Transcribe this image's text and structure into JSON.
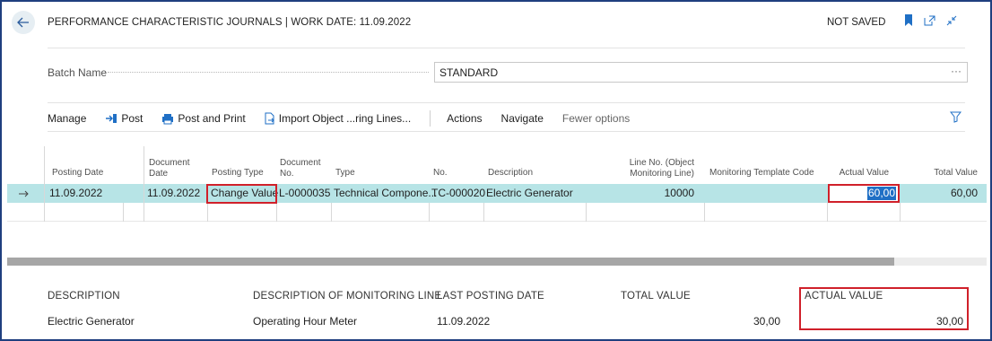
{
  "header": {
    "title": "PERFORMANCE CHARACTERISTIC JOURNALS | WORK DATE: 11.09.2022",
    "status": "NOT SAVED"
  },
  "batch": {
    "label": "Batch Name",
    "value": "STANDARD",
    "more": "···"
  },
  "actions": {
    "manage": "Manage",
    "post": "Post",
    "post_and_print": "Post and Print",
    "import": "Import Object ...ring Lines...",
    "actions": "Actions",
    "navigate": "Navigate",
    "fewer_options": "Fewer options"
  },
  "columns": {
    "posting_date": "Posting Date",
    "document_date": [
      "Document",
      "Date"
    ],
    "posting_type": "Posting Type",
    "document_no": [
      "Document",
      "No."
    ],
    "type": "Type",
    "no": "No.",
    "description": "Description",
    "line_no": [
      "Line No. (Object",
      "Monitoring Line)"
    ],
    "monitoring_template_code": "Monitoring Template Code",
    "actual_value": "Actual Value",
    "total_value": "Total Value"
  },
  "rows": [
    {
      "posting_date": "11.09.2022",
      "document_date": "11.09.2022",
      "posting_type": "Change Value",
      "document_no": "L-0000035",
      "type": "Technical Compone...",
      "no": "TC-000020",
      "description": "Electric Generator",
      "line_no": "10000",
      "monitoring_template_code": "",
      "actual_value": "60,00",
      "total_value": "60,00"
    }
  ],
  "factbox": {
    "description_label": "DESCRIPTION",
    "description_value": "Electric Generator",
    "monitoring_line_label": "DESCRIPTION OF MONITORING LINE",
    "monitoring_line_value": "Operating Hour Meter",
    "last_posting_label": "LAST POSTING DATE",
    "last_posting_value": "11.09.2022",
    "total_value_label": "TOTAL VALUE",
    "total_value_value": "30,00",
    "actual_value_label": "ACTUAL VALUE",
    "actual_value_value": "30,00"
  },
  "colors": {
    "selected_row": "#b7e4e6",
    "highlight": "#d0202a",
    "accent": "#1f6fc5"
  }
}
